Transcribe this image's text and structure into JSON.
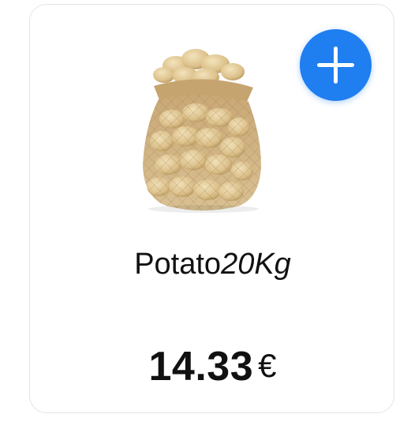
{
  "theme": {
    "accent": "#1f7ef0",
    "sack_color": "#d8bd8c",
    "potato_color": "#e6cf9c"
  },
  "product": {
    "image_icon": "potato-sack-image",
    "name": "Potato",
    "weight": "20Kg",
    "price": "14.33",
    "currency": "€"
  },
  "actions": {
    "add_icon": "plus-icon"
  }
}
